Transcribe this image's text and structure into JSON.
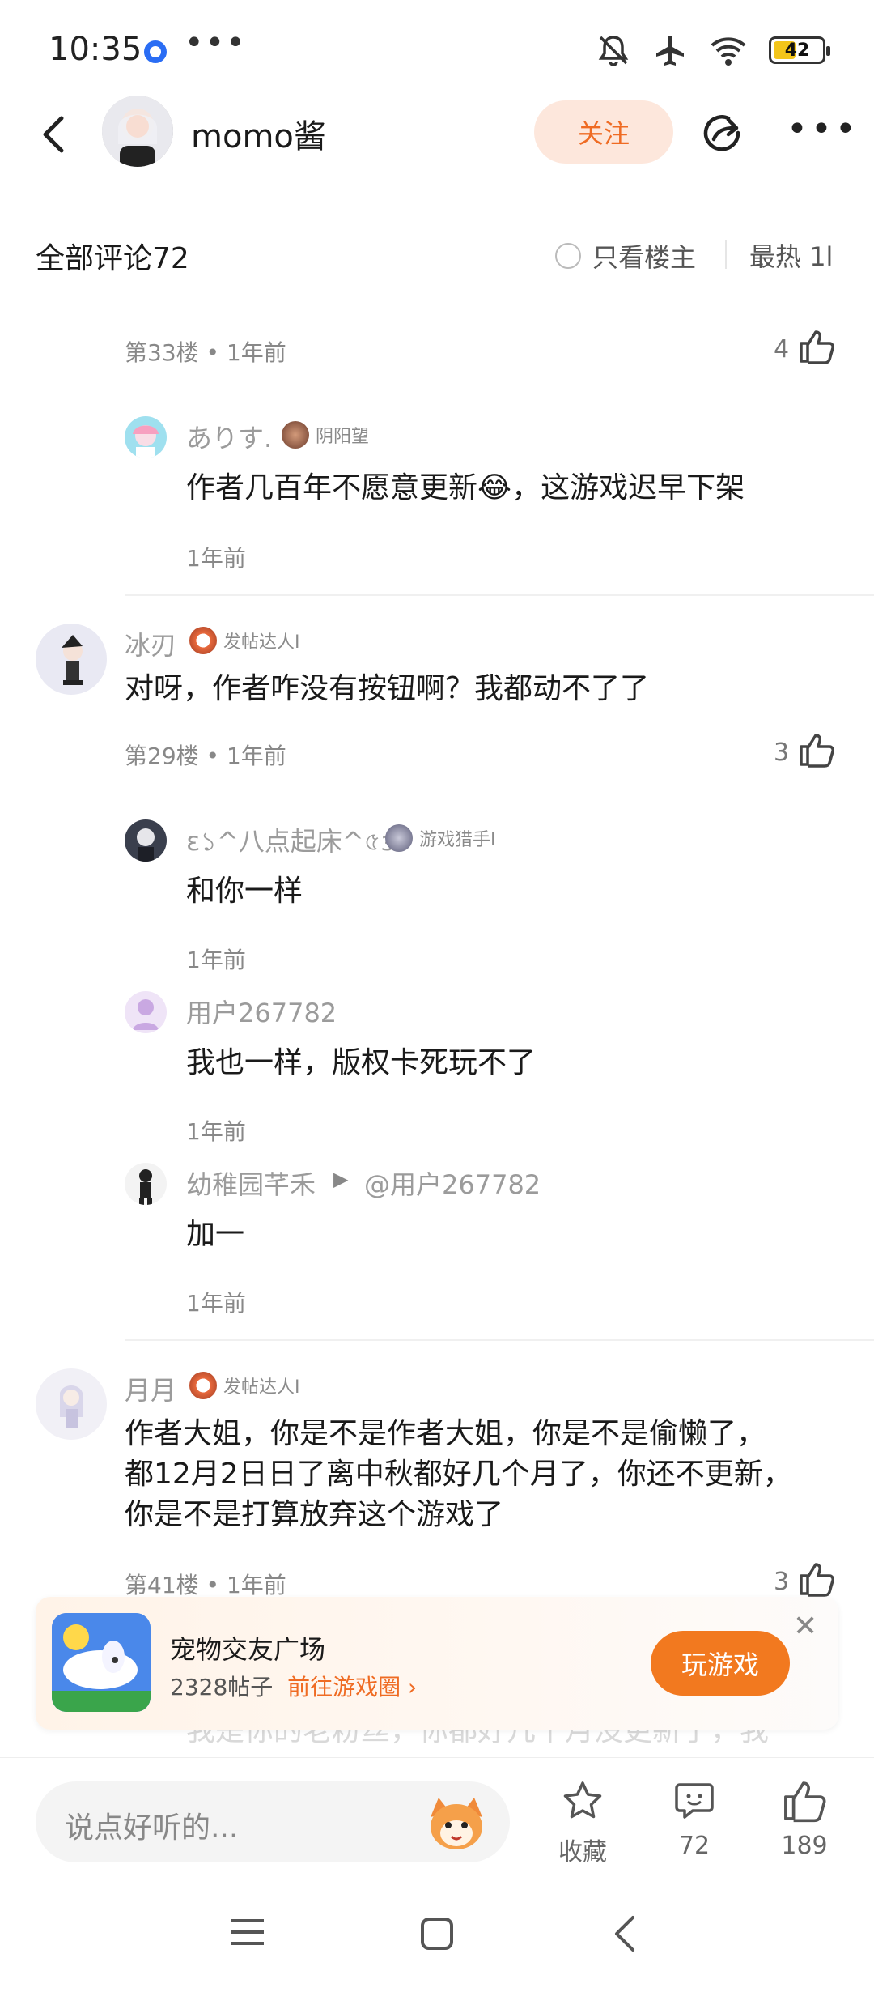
{
  "status_bar": {
    "time": "10:35",
    "more": "•••",
    "battery": "42"
  },
  "header": {
    "username": "momo酱",
    "follow_label": "关注"
  },
  "comments_header": {
    "title": "全部评论72",
    "owner_only": "只看楼主",
    "sort": "最热",
    "sort_suffix": "1l"
  },
  "thread_a": {
    "floor_meta": "第33楼 • 1年前",
    "like_count": "4",
    "replies": [
      {
        "name": "ありす.",
        "badge": "阴阳望",
        "text": "作者几百年不愿意更新😂，这游戏迟早下架",
        "time": "1年前"
      }
    ]
  },
  "thread_b": {
    "name": "冰刃",
    "badge": "发帖达人I",
    "text": "对呀，作者咋没有按钮啊？我都动不了了",
    "floor_meta": "第29楼 • 1年前",
    "like_count": "3",
    "replies": [
      {
        "name": "ɛ১^八点起床^৫з",
        "badge": "游戏猎手I",
        "text": "和你一样",
        "time": "1年前"
      },
      {
        "name": "用户267782",
        "text": "我也一样，版权卡死玩不了",
        "time": "1年前"
      },
      {
        "name": "幼稚园芊禾",
        "reply_to": "@用户267782",
        "text": "加一",
        "time": "1年前"
      }
    ]
  },
  "thread_c": {
    "name": "月月",
    "badge": "发帖达人I",
    "text_lines": [
      "作者大姐，你是不是作者大姐，你是不是偷懒了，",
      "都12月2日日了离中秋都好几个月了，你还不更新，",
      "你是不是打算放弃这个游戏了"
    ],
    "floor_meta": "第41楼 • 1年前",
    "like_count": "3"
  },
  "game_banner": {
    "title": "宠物交友广场",
    "posts": "2328帖子",
    "link": "前往游戏圈",
    "play_label": "玩游戏"
  },
  "peek_text": "我是你的老粉丝，你都好几个月没更新了，我",
  "bottom_bar": {
    "placeholder": "说点好听的...",
    "collect_label": "收藏",
    "comments_count": "72",
    "likes_count": "189"
  },
  "colors": {
    "accent": "#f2791f",
    "follow_bg": "#fde7dc",
    "follow_text": "#ef6b23"
  }
}
